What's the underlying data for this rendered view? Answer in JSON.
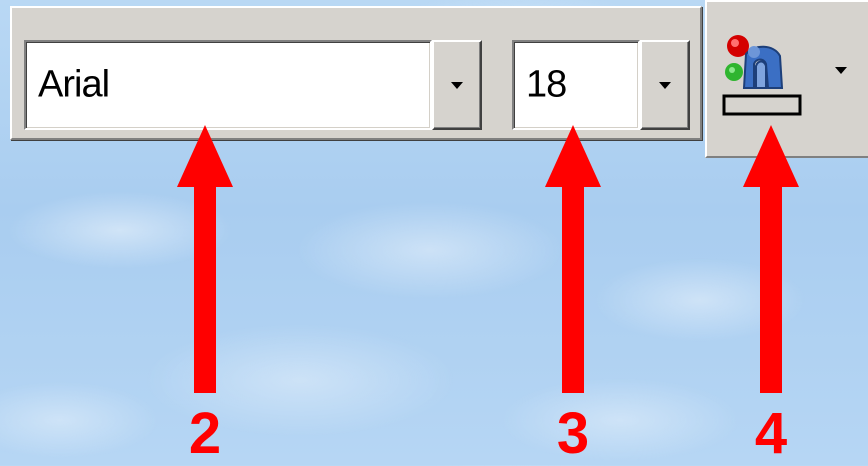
{
  "toolbar": {
    "font_name": {
      "value": "Arial",
      "dropdown_icon": "chevron-down-icon"
    },
    "font_size": {
      "value": "18",
      "dropdown_icon": "chevron-down-icon"
    },
    "fill_color": {
      "icon": "paint-bucket-icon",
      "dropdown_icon": "chevron-down-icon"
    }
  },
  "callouts": [
    {
      "number": "2",
      "target": "font_name"
    },
    {
      "number": "3",
      "target": "font_size"
    },
    {
      "number": "4",
      "target": "fill_color"
    }
  ],
  "colors": {
    "callout": "#ff0000",
    "toolbar_face": "#d6d3ce",
    "background": "#b0d2f2"
  }
}
